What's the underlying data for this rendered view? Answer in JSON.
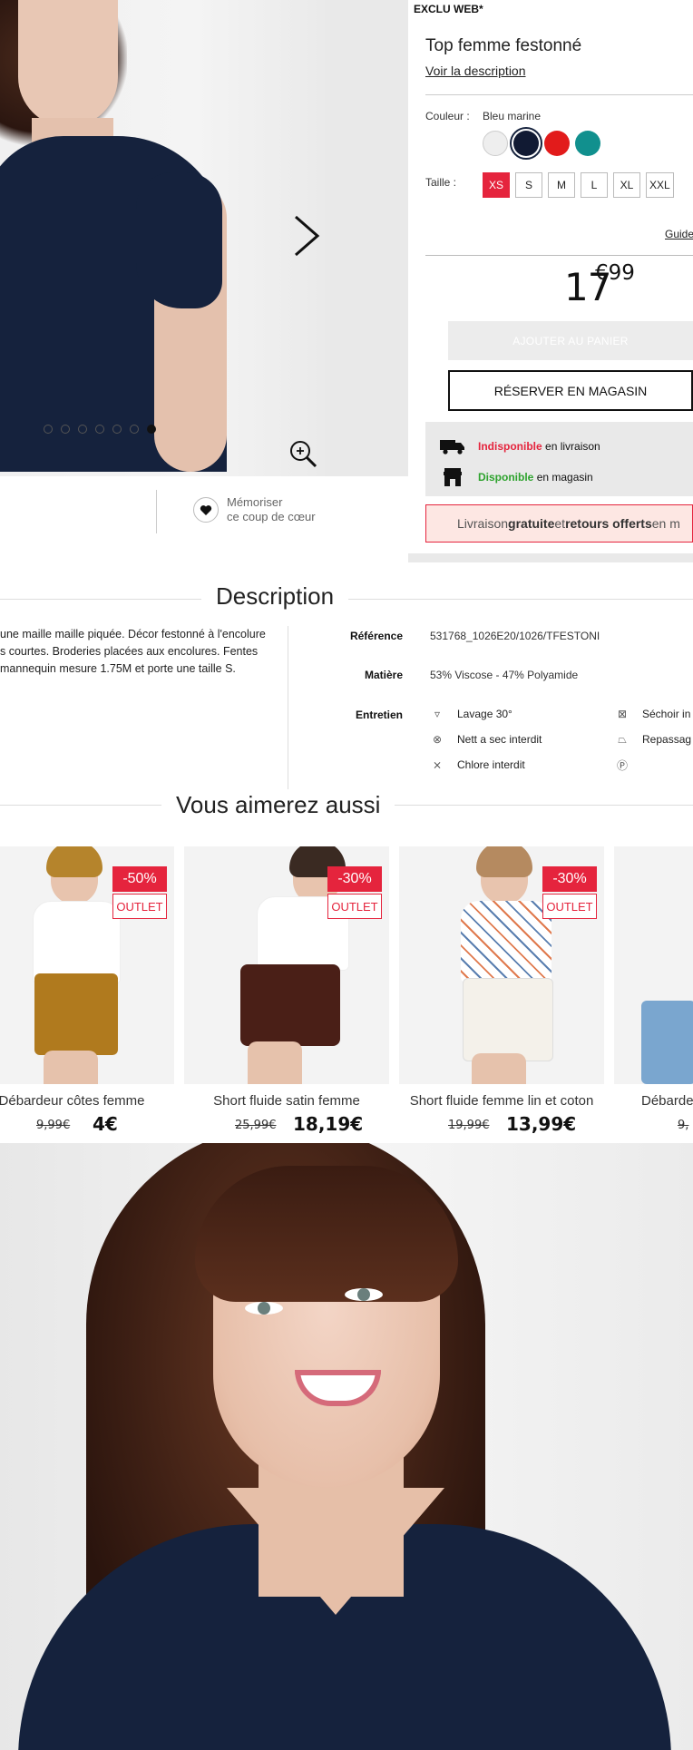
{
  "gallery": {
    "dots_count": 7,
    "active_dot": 6
  },
  "save": {
    "line1": "Mémoriser",
    "line2": "ce coup de cœur"
  },
  "product": {
    "badge": "EXCLU WEB*",
    "title": "Top femme festonné",
    "description_link": "Voir la description",
    "color_label": "Couleur :",
    "color_value": "Bleu marine",
    "colors": [
      "#eeeeee",
      "#111a33",
      "#e21b1b",
      "#11908e"
    ],
    "selected_color": 1,
    "size_label": "Taille :",
    "sizes": [
      "XS",
      "S",
      "M",
      "L",
      "XL",
      "XXL"
    ],
    "selected_size": 0,
    "size_guide": "Guide",
    "price_int": "17",
    "price_sup": "€99",
    "add_to_cart": "AJOUTER AU PANIER",
    "reserve": "RÉSERVER EN MAGASIN",
    "delivery_status": "Indisponible",
    "delivery_text": "en livraison",
    "store_status": "Disponible",
    "store_text": "en magasin",
    "promo_part1": "Livraison ",
    "promo_bold1": "gratuite",
    "promo_part2": " et ",
    "promo_bold2": "retours offerts",
    "promo_part3": " en m"
  },
  "description": {
    "title": "Description",
    "text_line1": "une maille maille piquée. Décor festonné à l'encolure",
    "text_line2": "s courtes. Broderies placées aux encolures. Fentes",
    "text_line3": "mannequin mesure 1.75M et porte une taille S.",
    "reference_label": "Référence",
    "reference_value": "531768_1026E20/1026/TFESTONI",
    "material_label": "Matière",
    "material_value": "53% Viscose - 47% Polyamide",
    "care_label": "Entretien",
    "care": [
      {
        "icon": "wash-30-icon",
        "glyph": "▿",
        "text": "Lavage 30°"
      },
      {
        "icon": "no-dry-clean-icon",
        "glyph": "⊗",
        "text": "Nett a sec interdit"
      },
      {
        "icon": "no-bleach-icon",
        "glyph": "⨯",
        "text": "Chlore interdit"
      },
      {
        "icon": "no-tumble-dry-icon",
        "glyph": "⊠",
        "text": "Séchoir in"
      },
      {
        "icon": "iron-icon",
        "glyph": "⏢",
        "text": "Repassag"
      },
      {
        "icon": "professional-care-icon",
        "glyph": "Ⓟ",
        "text": ""
      }
    ]
  },
  "recommendations": {
    "title": "Vous aimerez aussi",
    "items": [
      {
        "name": "Débardeur côtes femme",
        "old_price": "9,99€",
        "new_price": "4€",
        "discount": "-50%",
        "tag": "OUTLET"
      },
      {
        "name": "Short fluide satin femme",
        "old_price": "25,99€",
        "new_price": "18,19€",
        "discount": "-30%",
        "tag": "OUTLET"
      },
      {
        "name": "Short fluide femme lin et coton",
        "old_price": "19,99€",
        "new_price": "13,99€",
        "discount": "-30%",
        "tag": "OUTLET"
      },
      {
        "name": "Débarde",
        "old_price": "9,",
        "new_price": "",
        "discount": "",
        "tag": ""
      }
    ]
  }
}
